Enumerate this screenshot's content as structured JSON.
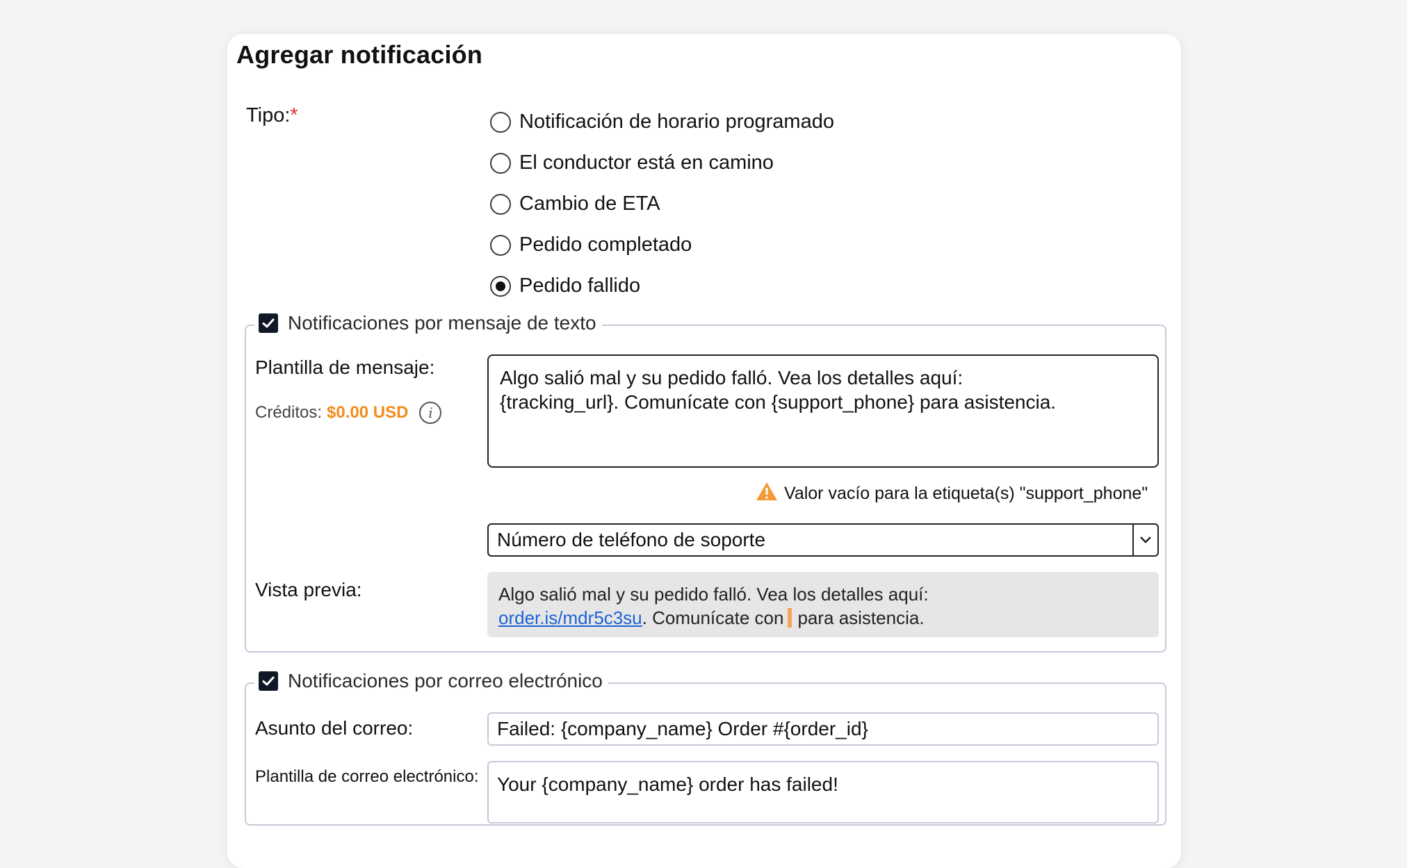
{
  "dialog": {
    "title": "Agregar notificación"
  },
  "type_field": {
    "label": "Tipo:",
    "required_mark": "*",
    "options": [
      {
        "label": "Notificación de horario programado",
        "selected": false
      },
      {
        "label": "El conductor está en camino",
        "selected": false
      },
      {
        "label": "Cambio de ETA",
        "selected": false
      },
      {
        "label": "Pedido completado",
        "selected": false
      },
      {
        "label": "Pedido fallido",
        "selected": true
      }
    ]
  },
  "sms": {
    "legend": "Notificaciones por mensaje de texto",
    "enabled": true,
    "template_label": "Plantilla de mensaje:",
    "credits_label": "Créditos:",
    "credits_amount": "$0.00 USD",
    "template_line1": "Algo salió mal y su pedido falló. Vea los detalles aquí:",
    "template_line2": "{tracking_url}. Comunícate con {support_phone} para asistencia.",
    "warning": "Valor vacío para la etiqueta(s) \"support_phone\"",
    "tag_select_value": "Número de teléfono de soporte",
    "preview_label": "Vista previa:",
    "preview_line1": "Algo salió mal y su pedido falló. Vea los detalles aquí:",
    "preview_link": "order.is/mdr5c3su",
    "preview_mid": ". Comunícate con",
    "preview_end": "para asistencia."
  },
  "email": {
    "legend": "Notificaciones por correo electrónico",
    "enabled": true,
    "subject_label": "Asunto del correo:",
    "subject_value": "Failed: {company_name} Order #{order_id}",
    "template_label": "Plantilla de correo electrónico:",
    "template_value": "Your {company_name} order has failed!"
  },
  "colors": {
    "accent": "#f28c1c",
    "link": "#1d62d6",
    "required": "#e03131",
    "checkbox": "#101827"
  },
  "icons": [
    "info-icon",
    "warning-icon",
    "chevron-down-icon",
    "check-icon"
  ]
}
